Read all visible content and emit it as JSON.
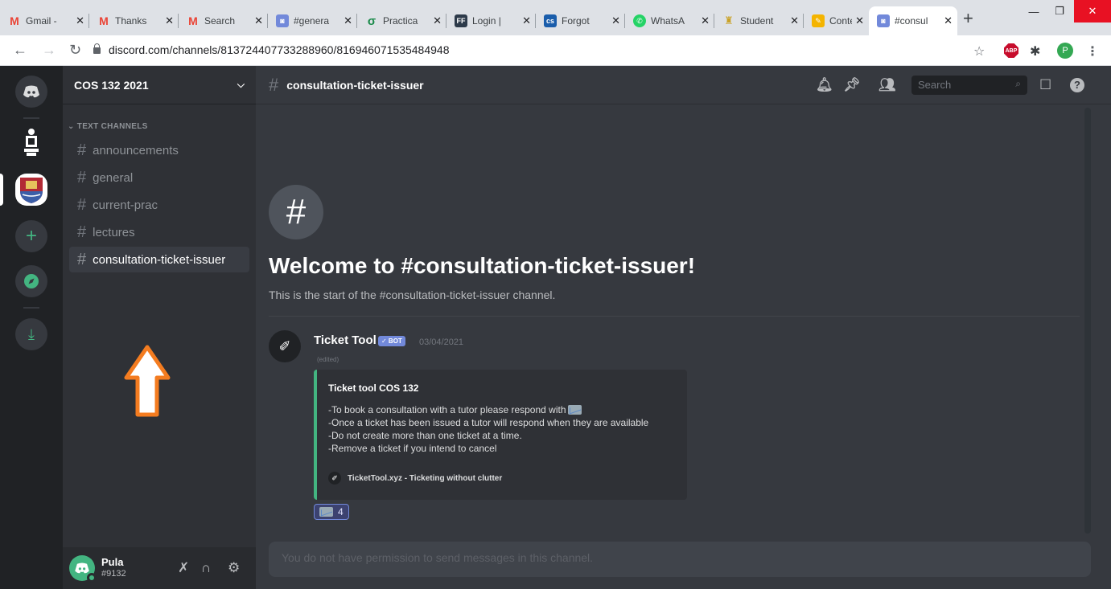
{
  "browser": {
    "tabs": [
      {
        "label": "Gmail -",
        "icon": "gmail-icon",
        "color": "#ea4335"
      },
      {
        "label": "Thanks",
        "icon": "gmail-icon",
        "color": "#ea4335"
      },
      {
        "label": "Search",
        "icon": "gmail-icon",
        "color": "#ea4335"
      },
      {
        "label": "#genera",
        "icon": "discord-icon",
        "color": "#7289da"
      },
      {
        "label": "Practica",
        "icon": "practica-icon",
        "color": "#1a8a4a"
      },
      {
        "label": "Login |",
        "icon": "ff-icon",
        "color": "#2d3a4a"
      },
      {
        "label": "Forgot",
        "icon": "cs-icon",
        "color": "#1a5dab"
      },
      {
        "label": "WhatsA",
        "icon": "whatsapp-icon",
        "color": "#25d366"
      },
      {
        "label": "Student",
        "icon": "university-icon",
        "color": "#c9a227"
      },
      {
        "label": "Content",
        "icon": "content-icon",
        "color": "#f4b400"
      },
      {
        "label": "#consul",
        "icon": "discord-icon",
        "color": "#7289da"
      }
    ],
    "url": "discord.com/channels/813724407733288960/816946071535484948",
    "profile_initial": "P",
    "abp_label": "ABP"
  },
  "server": {
    "name": "COS 132 2021",
    "category": "TEXT CHANNELS",
    "channels": [
      "announcements",
      "general",
      "current-prac",
      "lectures",
      "consultation-ticket-issuer"
    ]
  },
  "user": {
    "name": "Pula",
    "tag": "#9132"
  },
  "channel": {
    "name": "consultation-ticket-issuer",
    "search_placeholder": "Search",
    "welcome_title": "Welcome to #consultation-ticket-issuer!",
    "welcome_sub": "This is the start of the #consultation-ticket-issuer channel."
  },
  "message": {
    "author": "Ticket Tool",
    "badge": "✓ BOT",
    "timestamp": "03/04/2021",
    "edited": "(edited)",
    "embed": {
      "title": "Ticket tool COS 132",
      "lines": [
        "-To book a consultation with a tutor please respond with",
        "-Once a ticket has been issued a tutor will respond when they are available",
        "-Do not create more than one ticket at a time.",
        "-Remove a ticket if you intend to cancel"
      ],
      "footer": "TicketTool.xyz - Ticketing without clutter"
    },
    "reaction_count": "4"
  },
  "composer": {
    "placeholder": "You do not have permission to send messages in this channel."
  },
  "colors": {
    "accent": "#7289da",
    "online": "#43b581",
    "arrow": "#f47c20"
  }
}
